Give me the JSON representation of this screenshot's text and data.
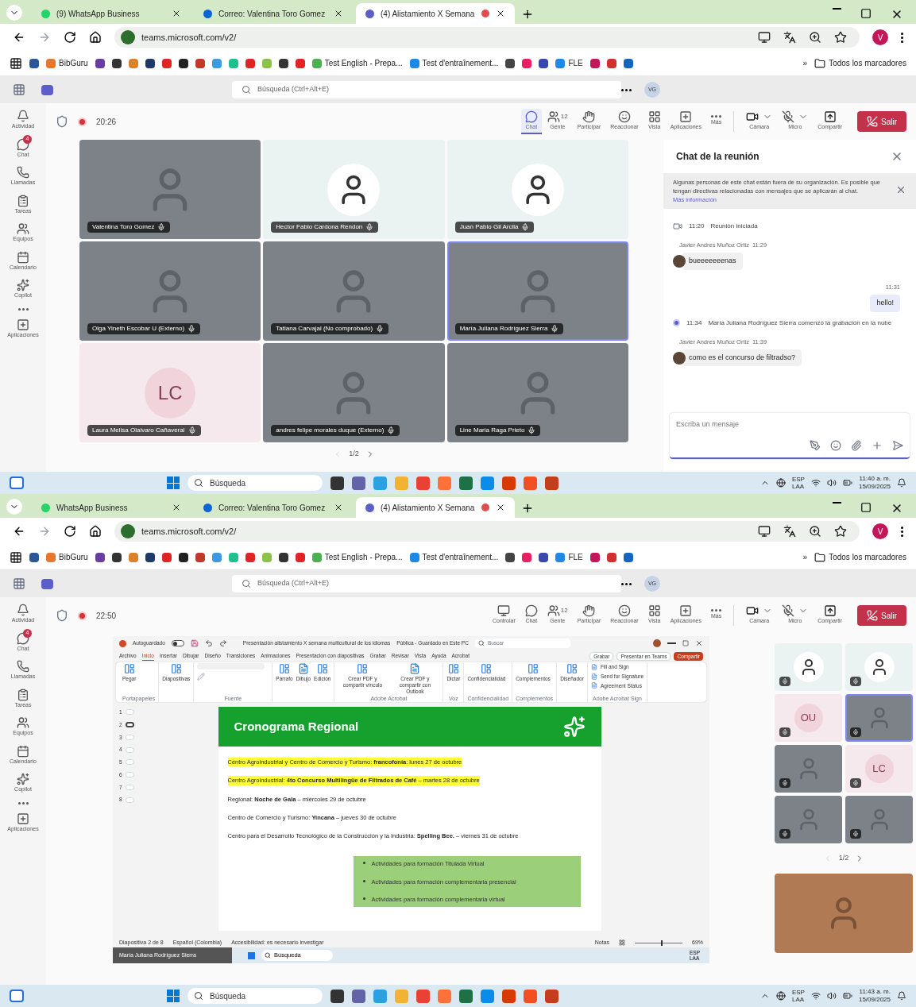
{
  "screens": [
    {
      "browser": {
        "tabs": [
          {
            "kind": "whatsapp",
            "title": "(9) WhatsApp Business",
            "selected": false,
            "recording": false
          },
          {
            "kind": "outlook",
            "title": "Correo: Valentina Toro Gomez",
            "selected": false,
            "recording": false
          },
          {
            "kind": "teams",
            "title": "(4) Alistamiento X Semana",
            "selected": true,
            "recording": true
          }
        ],
        "url": "teams.microsoft.com/v2/",
        "profile": "V",
        "bookmarks": [
          {
            "kind": "icon",
            "color": "#2b5797"
          },
          {
            "kind": "link",
            "label": "BibGuru",
            "color": "#e8772e"
          },
          {
            "kind": "icon",
            "color": "#6a3ea1"
          },
          {
            "kind": "icon",
            "color": "#333333"
          },
          {
            "kind": "icon",
            "color": "#d9822b"
          },
          {
            "kind": "icon",
            "color": "#1f3a68"
          },
          {
            "kind": "icon",
            "color": "#e02424"
          },
          {
            "kind": "icon",
            "color": "#222222"
          },
          {
            "kind": "icon",
            "color": "#c0392b"
          },
          {
            "kind": "icon",
            "color": "#3b9ae1"
          },
          {
            "kind": "icon",
            "color": "#1fbf8f"
          },
          {
            "kind": "icon",
            "color": "#e02425"
          },
          {
            "kind": "icon",
            "color": "#8bc34a"
          },
          {
            "kind": "icon",
            "color": "#333334"
          },
          {
            "kind": "icon",
            "color": "#e02426"
          },
          {
            "kind": "link",
            "label": "Test English - Prepa...",
            "color": "#4caf50"
          },
          {
            "kind": "link",
            "label": "Test d'entraînement...",
            "color": "#1e88e5"
          },
          {
            "kind": "icon",
            "color": "#444444"
          },
          {
            "kind": "icon",
            "color": "#e91e63"
          },
          {
            "kind": "icon",
            "color": "#3949ab"
          },
          {
            "kind": "link",
            "label": "FLE",
            "color": "#1e88e6"
          },
          {
            "kind": "icon",
            "color": "#c2185b"
          },
          {
            "kind": "icon",
            "color": "#d32f2f"
          },
          {
            "kind": "icon",
            "color": "#1565c0"
          }
        ],
        "more": "»",
        "folder": "Todos los marcadores"
      },
      "teams": {
        "search": "Búsqueda (Ctrl+Alt+E)",
        "avatar": "VG",
        "rail": [
          {
            "kind": "activity",
            "label": "Actividad"
          },
          {
            "kind": "chat",
            "label": "Chat",
            "badge": "4"
          },
          {
            "kind": "calls",
            "label": "Llamadas"
          },
          {
            "kind": "tasks",
            "label": "Tareas"
          },
          {
            "kind": "teams",
            "label": "Equipos"
          },
          {
            "kind": "calendar",
            "label": "Calendario"
          },
          {
            "kind": "copilot",
            "label": "Copilot"
          },
          {
            "kind": "more"
          },
          {
            "kind": "apps",
            "label": "Aplicaciones"
          }
        ],
        "timer": "20:26",
        "toolbar": [
          {
            "kind": "chat",
            "label": "Chat",
            "selected": true
          },
          {
            "kind": "people",
            "label": "Gente",
            "count": "12",
            "selected": false
          },
          {
            "kind": "raise",
            "label": "Participar",
            "selected": false
          },
          {
            "kind": "react",
            "label": "Reaccionar",
            "selected": false
          },
          {
            "kind": "view",
            "label": "Vista",
            "selected": false
          },
          {
            "kind": "apps",
            "label": "Aplicaciones",
            "selected": false
          },
          {
            "kind": "more",
            "label": "Más",
            "selected": false
          },
          {
            "kind": "camera",
            "label": "Cámara",
            "selected": false
          },
          {
            "kind": "mic",
            "label": "Micro",
            "selected": false
          },
          {
            "kind": "share",
            "label": "Compartir",
            "selected": false
          },
          {
            "kind": "leave",
            "label": "Salir"
          }
        ],
        "stage": {
          "kind": "gallery",
          "pager": "1/2",
          "tiles": [
            {
              "kind": "video",
              "name": "Valentina Toro Gomez",
              "speaking": false
            },
            {
              "kind": "photo",
              "name": "Hector Fabio Cardona Rendon",
              "speaking": false
            },
            {
              "kind": "photo",
              "name": "Juan Pablo Gil Arcila",
              "speaking": false
            },
            {
              "kind": "video",
              "name": "Olga Yineth Escobar U (Externo)",
              "speaking": false
            },
            {
              "kind": "video",
              "name": "Tatiana Carvajal (No comprobado)",
              "speaking": false
            },
            {
              "kind": "video",
              "name": "María Juliana Rodríguez Sierra",
              "speaking": true
            },
            {
              "kind": "initials",
              "initials": "LC",
              "name": "Laura Melisa Olaivaro Cañaveral",
              "speaking": false
            },
            {
              "kind": "video",
              "name": "andres felipe morales duque (Externo)",
              "speaking": false
            },
            {
              "kind": "video",
              "name": "Line Maria Raga Prieto",
              "speaking": false
            }
          ]
        },
        "chat": {
          "title": "Chat de la reunión",
          "notice": "Algunas personas de este chat están fuera de su organización. Es posible que tengan directivas relacionadas con mensajes que se aplicarán al chat.",
          "notice_link": "Más información",
          "composer": "Escriba un mensaje",
          "messages": [
            {
              "kind": "event",
              "time": "11:20",
              "text": "Reunión iniciada"
            },
            {
              "kind": "incoming",
              "sender": "Javier Andres Muñoz Ortiz",
              "time": "11:29",
              "text": "bueeeeeeenas"
            },
            {
              "kind": "outgoing",
              "time": "11:31",
              "text": "hello!"
            },
            {
              "kind": "recording",
              "time": "11:34",
              "text": "María Juliana Rodríguez Sierra comenzó la grabación en la nube"
            },
            {
              "kind": "incoming",
              "sender": "Javier Andres Muñoz Ortiz",
              "time": "11:39",
              "text": "como es el concurso de filtradso?"
            }
          ]
        }
      },
      "taskbar": {
        "search": "Búsqueda",
        "apps": [
          {
            "color": "#333333"
          },
          {
            "color": "#6264a7"
          },
          {
            "color": "#2aa1e0"
          },
          {
            "color": "#f2b233"
          },
          {
            "color": "#e94235"
          },
          {
            "color": "#ff7139"
          },
          {
            "color": "#1e7145"
          },
          {
            "color": "#0c8ce9"
          },
          {
            "color": "#d83b01"
          },
          {
            "color": "#f25022"
          },
          {
            "color": "#c43e1c"
          }
        ],
        "lang": "ESP",
        "region": "LAA",
        "time": "11:40 a. m.",
        "date": "15/09/2025"
      }
    },
    {
      "browser": {
        "tabs": [
          {
            "kind": "whatsapp",
            "title": "WhatsApp Business",
            "selected": false,
            "recording": false
          },
          {
            "kind": "outlook",
            "title": "Correo: Valentina Toro Gomez",
            "selected": false,
            "recording": false
          },
          {
            "kind": "teams",
            "title": "(4) Alistamiento X Semana",
            "selected": true,
            "recording": true
          }
        ],
        "url": "teams.microsoft.com/v2/",
        "profile": "V",
        "bookmarks": [
          {
            "kind": "icon",
            "color": "#2b5797"
          },
          {
            "kind": "link",
            "label": "BibGuru",
            "color": "#e8772e"
          },
          {
            "kind": "icon",
            "color": "#6a3ea1"
          },
          {
            "kind": "icon",
            "color": "#333333"
          },
          {
            "kind": "icon",
            "color": "#d9822b"
          },
          {
            "kind": "icon",
            "color": "#1f3a68"
          },
          {
            "kind": "icon",
            "color": "#e02424"
          },
          {
            "kind": "icon",
            "color": "#222222"
          },
          {
            "kind": "icon",
            "color": "#c0392b"
          },
          {
            "kind": "icon",
            "color": "#3b9ae1"
          },
          {
            "kind": "icon",
            "color": "#1fbf8f"
          },
          {
            "kind": "icon",
            "color": "#e02425"
          },
          {
            "kind": "icon",
            "color": "#8bc34a"
          },
          {
            "kind": "icon",
            "color": "#333334"
          },
          {
            "kind": "icon",
            "color": "#e02426"
          },
          {
            "kind": "link",
            "label": "Test English - Prepa...",
            "color": "#4caf50"
          },
          {
            "kind": "link",
            "label": "Test d'entraînement...",
            "color": "#1e88e5"
          },
          {
            "kind": "icon",
            "color": "#444444"
          },
          {
            "kind": "icon",
            "color": "#e91e63"
          },
          {
            "kind": "icon",
            "color": "#3949ab"
          },
          {
            "kind": "link",
            "label": "FLE",
            "color": "#1e88e6"
          },
          {
            "kind": "icon",
            "color": "#c2185b"
          },
          {
            "kind": "icon",
            "color": "#d32f2f"
          },
          {
            "kind": "icon",
            "color": "#1565c0"
          }
        ],
        "more": "»",
        "folder": "Todos los marcadores"
      },
      "teams": {
        "search": "Búsqueda (Ctrl+Alt+E)",
        "avatar": "VG",
        "rail": [
          {
            "kind": "activity",
            "label": "Actividad"
          },
          {
            "kind": "chat",
            "label": "Chat",
            "badge": "4"
          },
          {
            "kind": "calls",
            "label": "Llamadas"
          },
          {
            "kind": "tasks",
            "label": "Tareas"
          },
          {
            "kind": "teams",
            "label": "Equipos"
          },
          {
            "kind": "calendar",
            "label": "Calendario"
          },
          {
            "kind": "copilot",
            "label": "Copilot"
          },
          {
            "kind": "more"
          },
          {
            "kind": "apps",
            "label": "Aplicaciones"
          }
        ],
        "timer": "22:50",
        "toolbar": [
          {
            "kind": "control",
            "label": "Controlar",
            "selected": false
          },
          {
            "kind": "chat",
            "label": "Chat",
            "selected": false
          },
          {
            "kind": "people",
            "label": "Gente",
            "count": "12",
            "selected": false
          },
          {
            "kind": "raise",
            "label": "Participar",
            "selected": false
          },
          {
            "kind": "react",
            "label": "Reaccionar",
            "selected": false
          },
          {
            "kind": "view",
            "label": "Vista",
            "selected": false
          },
          {
            "kind": "apps",
            "label": "Aplicaciones",
            "selected": false
          },
          {
            "kind": "more",
            "label": "Más",
            "selected": false
          },
          {
            "kind": "camera",
            "label": "Cámara",
            "selected": false
          },
          {
            "kind": "mic",
            "label": "Micro",
            "selected": false
          },
          {
            "kind": "share",
            "label": "Compartir",
            "selected": false
          },
          {
            "kind": "leave",
            "label": "Salir"
          }
        ],
        "stage": {
          "kind": "share",
          "presenter": "María Juliana Rodríguez Sierra",
          "pager": "1/2",
          "ppt": {
            "autosave": "Autoguardado",
            "autosave_on": false,
            "title": "Presentación alistamiento X semana multicultural de los idiomas",
            "status": "Pública - Guardado en Este PC",
            "search": "Buscar",
            "menu": [
              {
                "label": "Archivo",
                "selected": false
              },
              {
                "label": "Inicio",
                "selected": true
              },
              {
                "label": "Insertar",
                "selected": false
              },
              {
                "label": "Dibujar",
                "selected": false
              },
              {
                "label": "Diseño",
                "selected": false
              },
              {
                "label": "Transiciones",
                "selected": false
              },
              {
                "label": "Animaciones",
                "selected": false
              },
              {
                "label": "Presentación con diapositivas",
                "selected": false
              },
              {
                "label": "Grabar",
                "selected": false
              },
              {
                "label": "Revisar",
                "selected": false
              },
              {
                "label": "Vista",
                "selected": false
              },
              {
                "label": "Ayuda",
                "selected": false
              },
              {
                "label": "Acrobat",
                "selected": false
              }
            ],
            "actions": [
              {
                "kind": "record",
                "label": "Grabar"
              },
              {
                "kind": "teams",
                "label": "Presentar en Teams"
              },
              {
                "kind": "share",
                "label": "Compartir"
              }
            ],
            "ribbon": [
              {
                "label": "Portapapeles",
                "kind": "big",
                "items": [
                  "Pegar"
                ]
              },
              {
                "kind": "big",
                "items": [
                  "Diapositivas"
                ]
              },
              {
                "label": "Fuente",
                "kind": "font"
              },
              {
                "kind": "big",
                "items": [
                  "Párrafo",
                  "Dibujo",
                  "Edición"
                ]
              },
              {
                "label": "Adobe Acrobat",
                "kind": "big",
                "items": [
                  "Crear PDF y compartir vínculo",
                  "Crear PDF y compartir con Outlook"
                ]
              },
              {
                "label": "Voz",
                "kind": "big",
                "items": [
                  "Dictar"
                ]
              },
              {
                "label": "Confidencialidad",
                "kind": "big",
                "items": [
                  "Confidencialidad"
                ]
              },
              {
                "label": "Complementos",
                "kind": "big",
                "items": [
                  "Complementos"
                ]
              },
              {
                "kind": "big",
                "items": [
                  "Diseñador"
                ]
              },
              {
                "label": "Adobe Acrobat Sign",
                "kind": "list",
                "items": [
                  "Fill and Sign",
                  "Send for Signature",
                  "Agreement Status"
                ]
              }
            ],
            "thumbnails": [
              {
                "number": "1",
                "selected": false
              },
              {
                "number": "2",
                "selected": true
              },
              {
                "number": "3",
                "selected": false
              },
              {
                "number": "4",
                "selected": false
              },
              {
                "number": "5",
                "selected": false
              },
              {
                "number": "6",
                "selected": false
              },
              {
                "number": "7",
                "selected": false
              },
              {
                "number": "8",
                "selected": false
              }
            ],
            "slide": {
              "title": "Cronograma Regional",
              "lines": [
                {
                  "text": "Centro Agroindustrial y Centro de Comercio y Turismo: **francofonía**: lunes 27 de octubre",
                  "highlight": true
                },
                {
                  "text": "Centro Agroindustrial: **4to Concurso Multilingüe de Filtrados de Café** – martes 28 de octubre",
                  "highlight": true
                },
                {
                  "text": "Regional: **Noche de Gala** – miércoles 29 de octubre",
                  "highlight": false
                },
                {
                  "text": "Centro de Comercio y Turismo: **Yincana** – jueves 30 de octubre",
                  "highlight": false
                },
                {
                  "text": "Centro para el Desarrollo Tecnológico de la Construcción y la Industria: **Spelling Bee.** – viernes 31 de octubre",
                  "highlight": false
                }
              ],
              "bullets": [
                "Actividades para formación Titulada Virtual",
                "Actividades para formación complementaria presencial",
                "Actividades para formación complementaria virtual"
              ]
            },
            "statusbar": {
              "slide": "Diapositiva 2 de 8",
              "language": "Español (Colombia)",
              "accessibility": "Accesibilidad: es necesario investigar",
              "notes": "Notas",
              "zoom_slider": {
                "level": 0.55
              },
              "zoom": "69%"
            }
          },
          "mini_taskbar": {
            "search": "Búsqueda",
            "lang": "ESP",
            "region": "LAA"
          },
          "side_tiles": [
            {
              "kind": "photo",
              "speaking": false
            },
            {
              "kind": "photo",
              "speaking": false
            },
            {
              "kind": "initials",
              "initials": "OU",
              "speaking": false
            },
            {
              "kind": "video",
              "speaking": true
            },
            {
              "kind": "video",
              "speaking": false
            },
            {
              "kind": "initials",
              "initials": "LC",
              "speaking": false
            },
            {
              "kind": "video",
              "speaking": false
            },
            {
              "kind": "video",
              "speaking": false
            }
          ]
        }
      },
      "taskbar": {
        "search": "Búsqueda",
        "apps": [
          {
            "color": "#333333"
          },
          {
            "color": "#6264a7"
          },
          {
            "color": "#2aa1e0"
          },
          {
            "color": "#f2b233"
          },
          {
            "color": "#e94235"
          },
          {
            "color": "#ff7139"
          },
          {
            "color": "#1e7145"
          },
          {
            "color": "#0c8ce9"
          },
          {
            "color": "#d83b01"
          },
          {
            "color": "#f25022"
          },
          {
            "color": "#c43e1c"
          }
        ],
        "lang": "ESP",
        "region": "LAA",
        "time": "11:43 a. m.",
        "date": "15/09/2025"
      }
    }
  ]
}
